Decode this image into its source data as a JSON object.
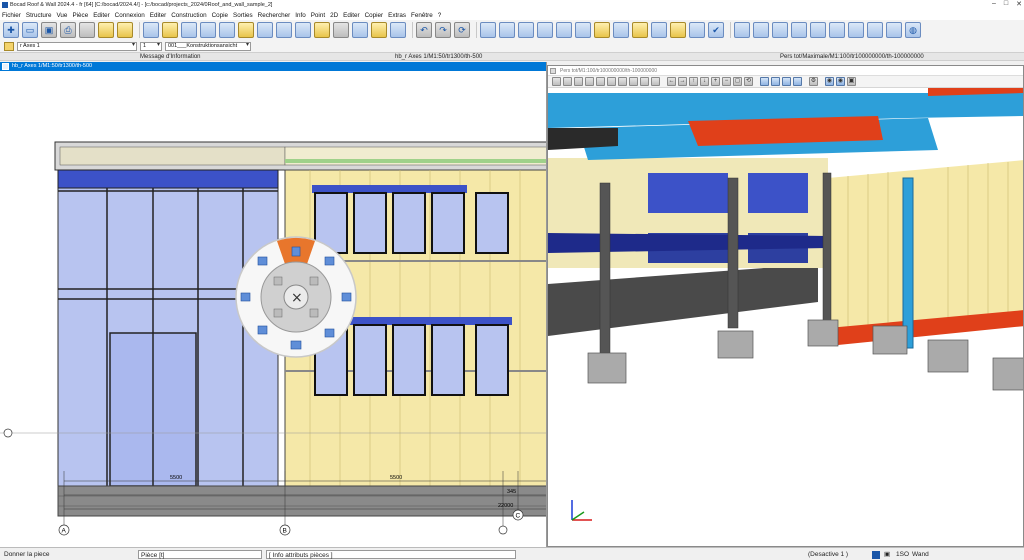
{
  "app": {
    "title": "Bocad Roof & Wall 2024.4 - fr [64] [C:/bocad/2024.4/] - [c:/bocad/projects_2024/0Roof_and_wall_sample_2]"
  },
  "window_controls": {
    "minimize": "–",
    "maximize": "□",
    "close": "✕"
  },
  "menu": [
    "Fichier",
    "Structure",
    "Vue",
    "Pièce",
    "Editer",
    "Connexion",
    "Editer",
    "Construction",
    "Copie",
    "Sorties",
    "Rechercher",
    "Info",
    "Point",
    "2D",
    "Editer",
    "Copier",
    "Extras",
    "Fenêtre",
    "?"
  ],
  "toolbar": {
    "icons": [
      "new-file-icon",
      "open-folder-icon",
      "save-icon",
      "print-icon",
      "print-preview-icon",
      "copy-icon",
      "paste-icon",
      "object-icon",
      "node-icon",
      "axis-icon",
      "curve-icon",
      "section-icon",
      "transfer-icon",
      "plate-icon",
      "beam-icon",
      "frame-icon",
      "member-icon",
      "grid-icon",
      "insert-icon",
      "select-icon",
      "layer-icon",
      "undo-icon",
      "redo-icon",
      "refresh-icon",
      "weld-icon",
      "bolt-icon",
      "connection-icon",
      "stiffener-icon",
      "column-icon",
      "brace-icon",
      "purlin-icon",
      "cladding-icon",
      "dimension-icon",
      "axes-icon",
      "measure-icon",
      "view-icon",
      "check-icon",
      "export-icon",
      "import-icon",
      "part-list-icon",
      "drawing-icon",
      "nc-icon",
      "step-icon",
      "report-icon",
      "ifc-icon",
      "dxf-icon",
      "globe-icon"
    ]
  },
  "selectors": {
    "axis": "r Axes 1",
    "number": "1",
    "layer": "001___Konstruktionsansicht"
  },
  "pane_headers": {
    "message": "Message d'Information",
    "left_view": "hb_r Axes 1/M1:50/tr1300/th-500",
    "right_view": "Pers tot/Maximale/M1:100/tr100000000/th-100000000"
  },
  "left_view": {
    "tab_title": "hb_r Axes 1/M1:50/tr1300/th-500",
    "dimensions": [
      "5500",
      "5500",
      "345",
      "22000"
    ],
    "axes": [
      "A",
      "B",
      "C"
    ]
  },
  "right_view": {
    "tab_title": "Pers tot/M1:100/tr100000000/th-100000000"
  },
  "status": {
    "prompt": "Donner la piece",
    "mode": "Pièce [t]",
    "info": "[ Info attributs pièces ]",
    "deactivate": "(Desactive 1 )",
    "layer": "1SO",
    "wand": "Wand"
  },
  "colors": {
    "accent": "#0078d7",
    "steel_blue": "#2d9fd9",
    "insulation": "#f5e8a8",
    "glass": "#b8c4f0",
    "red": "#e0401a"
  }
}
